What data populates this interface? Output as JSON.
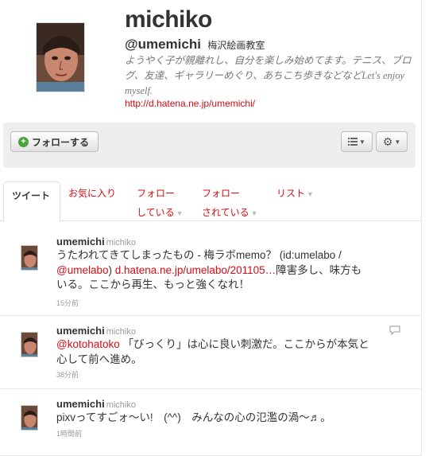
{
  "profile": {
    "name": "michiko",
    "handle": "@umemichi",
    "location": "梅沢絵画教室",
    "bio": "ようやく子が親離れし、自分を楽しみ始めてます。テニス、ブログ、友達、ギャラリーめぐり、あちこち歩きなどなどLet's enjoy myself.",
    "url": "http://d.hatena.ne.jp/umemichi/"
  },
  "actions": {
    "follow_label": "フォローする",
    "list_icon": "list-icon",
    "gear_icon": "gear-icon"
  },
  "tabs": {
    "tweets": "ツイート",
    "favorites": "お気に入り",
    "following_1": "フォロー",
    "following_2": "している",
    "followers_1": "フォロー",
    "followers_2": "されている",
    "lists": "リスト"
  },
  "tweets": [
    {
      "user": "umemichi",
      "name": "michiko",
      "line1": "うたわれてきてしまったもの - 梅ラボmemo？ (id:umelabo /",
      "mention": "@umelabo",
      "mid": ") ",
      "link": "d.hatena.ne.jp/umelabo/201105…",
      "rest": "障害多し、味方も",
      "line3": "いる。ここから再生、もっと強くなれ！",
      "time": "15分前"
    },
    {
      "user": "umemichi",
      "name": "michiko",
      "mention": "@kotohatoko",
      "rest": "「びっくり」は心に良い刺激だ。ここからが本気と",
      "line2": "心して前へ進め。",
      "time": "38分前"
    },
    {
      "user": "umemichi",
      "name": "michiko",
      "text": "pixvってすごォ〜い!　(^^)　みんなの心の氾濫の渦〜♬。",
      "time": "1時間前"
    }
  ],
  "colors": {
    "accent": "#d40d12",
    "muted": "#999999",
    "bar": "#eeeeee"
  }
}
